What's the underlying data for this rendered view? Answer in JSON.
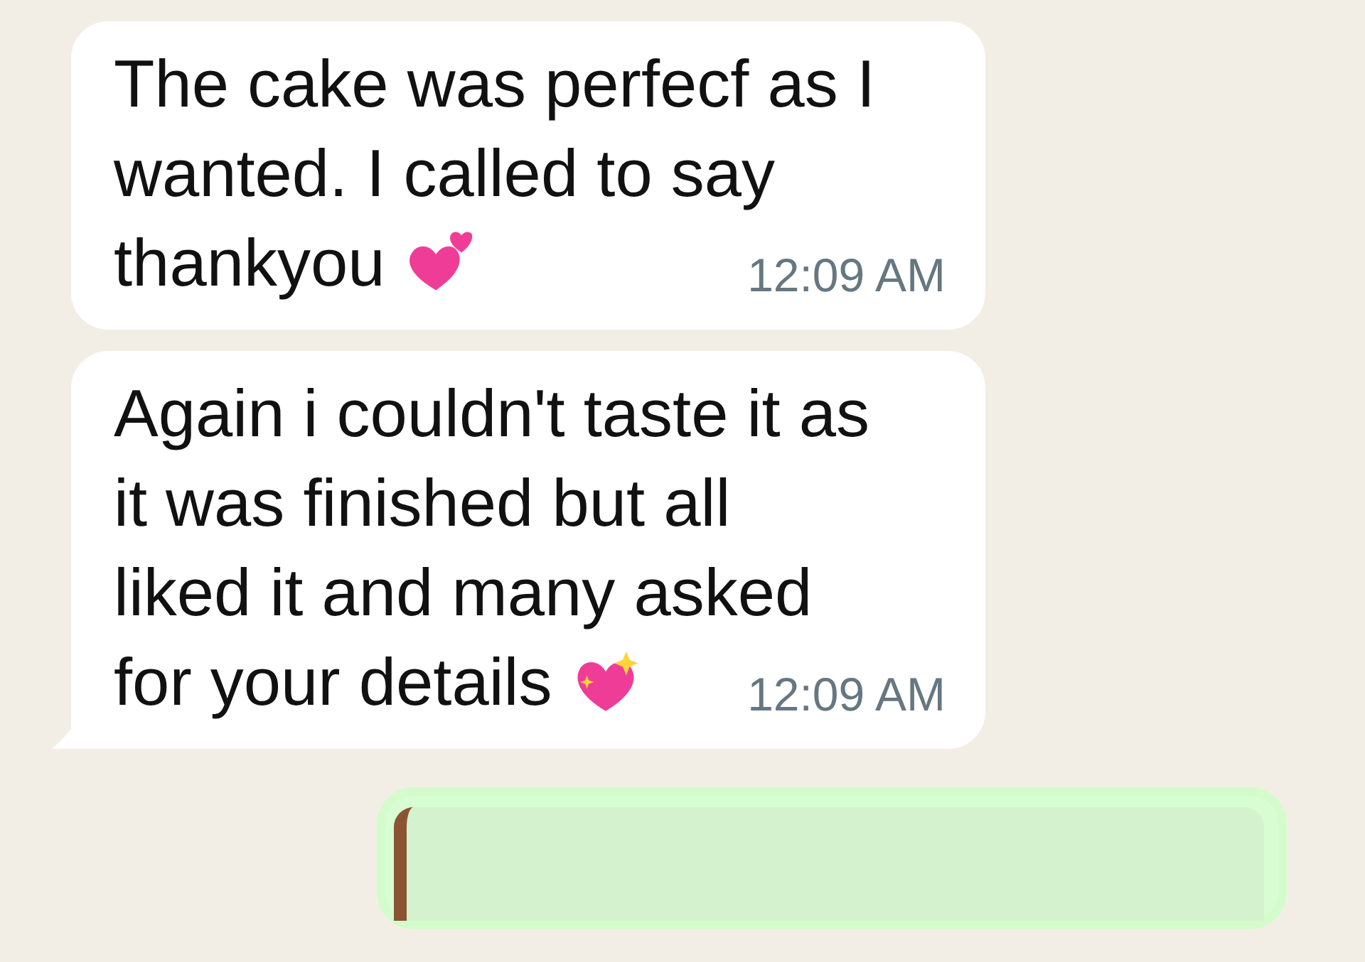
{
  "messages": [
    {
      "kind": "incoming",
      "lines": [
        "The cake was perfecf as I",
        "wanted. I called to say",
        "thankyou"
      ],
      "icon": {
        "kind": "two-hearts"
      },
      "time": "12:09 AM",
      "tail": false
    },
    {
      "kind": "incoming",
      "lines": [
        "Again i couldn't taste it as",
        "it was finished but all",
        "liked it and many asked",
        "for your details"
      ],
      "icon": {
        "kind": "sparkling-heart"
      },
      "time": "12:09 AM",
      "tail": true
    },
    {
      "kind": "outgoing-quote"
    }
  ]
}
